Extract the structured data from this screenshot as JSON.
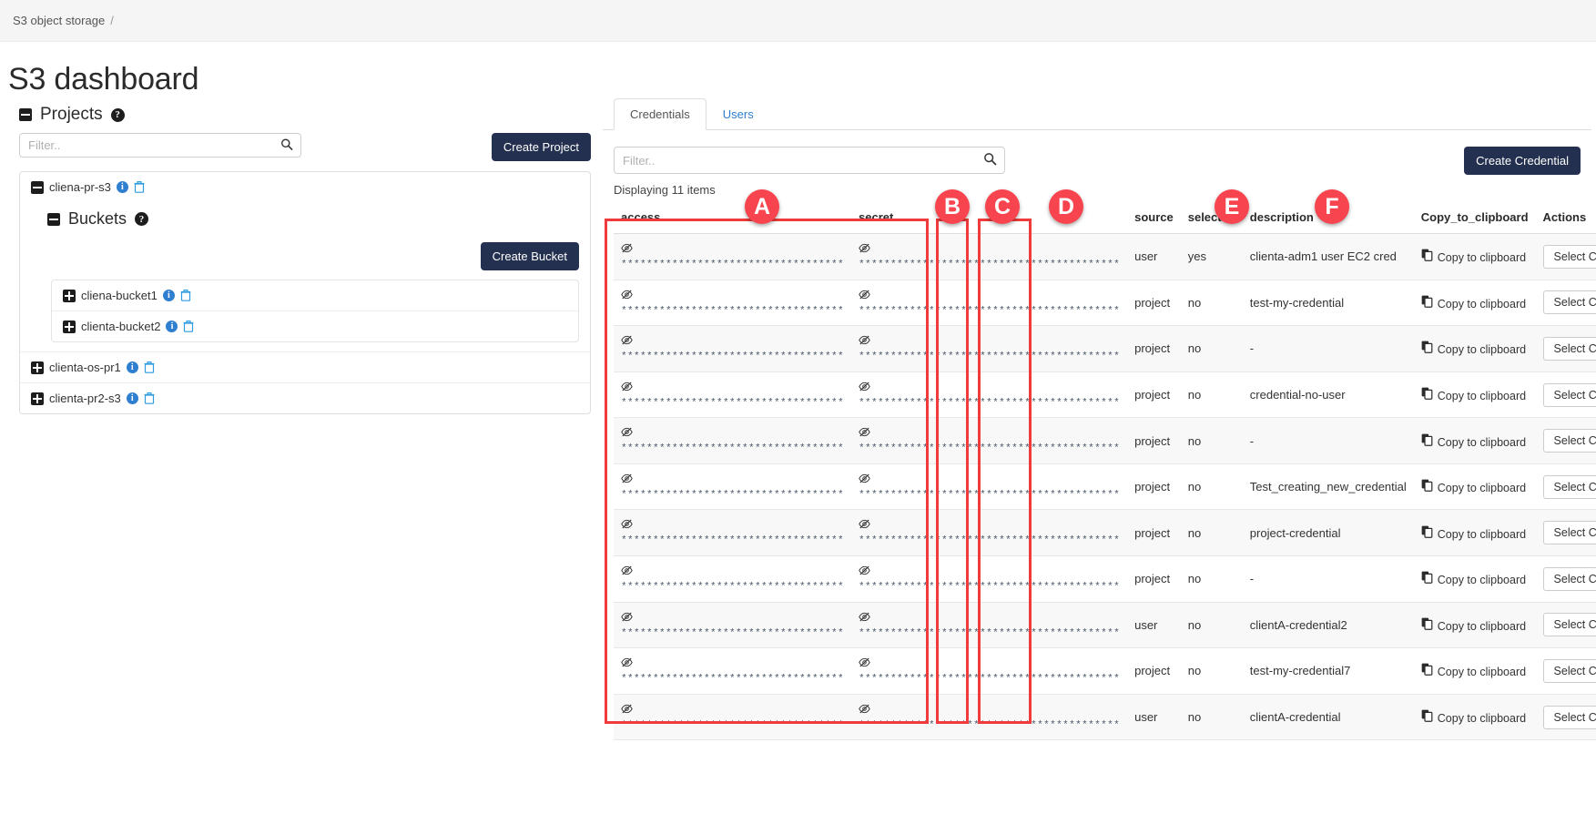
{
  "breadcrumb": {
    "root": "S3 object storage",
    "separator": "/"
  },
  "page": {
    "title": "S3 dashboard"
  },
  "projects_section": {
    "heading": "Projects",
    "help_icon": "question-circle-icon",
    "filter_placeholder": "Filter..",
    "filter_value": "",
    "create_button": "Create Project",
    "buckets_heading": "Buckets",
    "create_bucket_button": "Create Bucket",
    "items": [
      {
        "name": "cliena-pr-s3",
        "expanded": true
      },
      {
        "name": "clienta-os-pr1",
        "expanded": false
      },
      {
        "name": "clienta-pr2-s3",
        "expanded": false
      }
    ],
    "buckets": [
      {
        "name": "cliena-bucket1"
      },
      {
        "name": "clienta-bucket2"
      }
    ]
  },
  "credentials_panel": {
    "tabs": [
      {
        "label": "Credentials",
        "active": true
      },
      {
        "label": "Users",
        "active": false
      }
    ],
    "filter_placeholder": "Filter..",
    "filter_value": "",
    "create_button": "Create Credential",
    "displaying": "Displaying 11 items",
    "columns": [
      "access",
      "secret",
      "source",
      "selected",
      "description",
      "Copy_to_clipboard",
      "Actions"
    ],
    "masked_access": "***********************************",
    "masked_secret": "*****************************************",
    "copy_label": "Copy to clipboard",
    "action_label": "Select Credential",
    "rows": [
      {
        "source": "user",
        "selected": "yes",
        "description": "clienta-adm1 user EC2 cred"
      },
      {
        "source": "project",
        "selected": "no",
        "description": "test-my-credential"
      },
      {
        "source": "project",
        "selected": "no",
        "description": "-"
      },
      {
        "source": "project",
        "selected": "no",
        "description": "credential-no-user"
      },
      {
        "source": "project",
        "selected": "no",
        "description": "-"
      },
      {
        "source": "project",
        "selected": "no",
        "description": "Test_creating_new_credential"
      },
      {
        "source": "project",
        "selected": "no",
        "description": "project-credential"
      },
      {
        "source": "project",
        "selected": "no",
        "description": "-"
      },
      {
        "source": "user",
        "selected": "no",
        "description": "clientA-credential2"
      },
      {
        "source": "project",
        "selected": "no",
        "description": "test-my-credential7"
      },
      {
        "source": "user",
        "selected": "no",
        "description": "clientA-credential"
      }
    ]
  },
  "annotations": {
    "color": "#f7444e",
    "markers": [
      {
        "letter": "A",
        "target": "access-and-secret-columns"
      },
      {
        "letter": "B",
        "target": "source-column"
      },
      {
        "letter": "C",
        "target": "selected-column"
      },
      {
        "letter": "D",
        "target": "description-column"
      },
      {
        "letter": "E",
        "target": "copy-to-clipboard-column"
      },
      {
        "letter": "F",
        "target": "actions-column"
      }
    ]
  }
}
